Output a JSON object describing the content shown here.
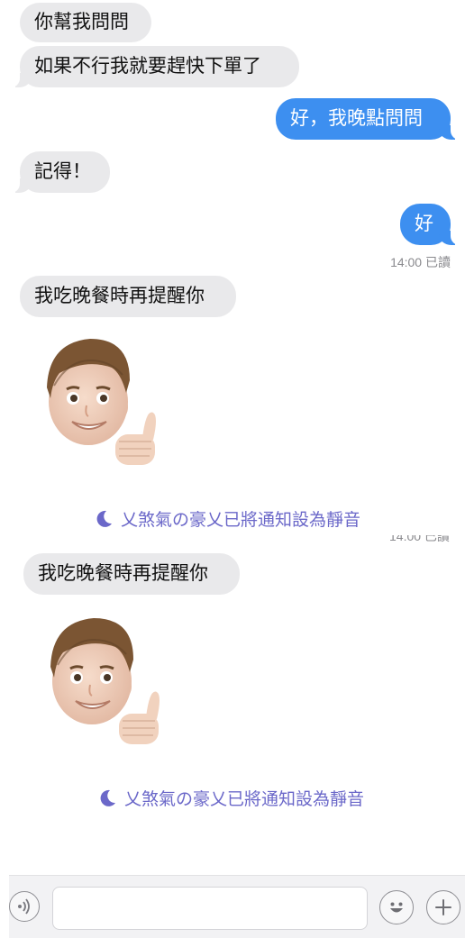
{
  "messages": {
    "m1": "你幫我問問",
    "m2": "如果不行我就要趕快下單了",
    "m3": "好，我晚點問問",
    "m4": "記得！",
    "m5": "好",
    "m6": "我吃晚餐時再提醒你",
    "m7": "我吃晚餐時再提醒你"
  },
  "receipt": {
    "text": "14:00 已讀"
  },
  "notice": {
    "text": "乂煞氣の豪乂已將通知設為靜音"
  },
  "composer": {
    "input_value": ""
  },
  "colors": {
    "incoming": "#e9e9eb",
    "outgoing": "#3d8ff0",
    "notice": "#6b68c9"
  },
  "icons": {
    "voice": "voice-wave-icon",
    "emoji": "smiley-face-icon",
    "add": "plus-icon",
    "muted": "moon-icon"
  }
}
